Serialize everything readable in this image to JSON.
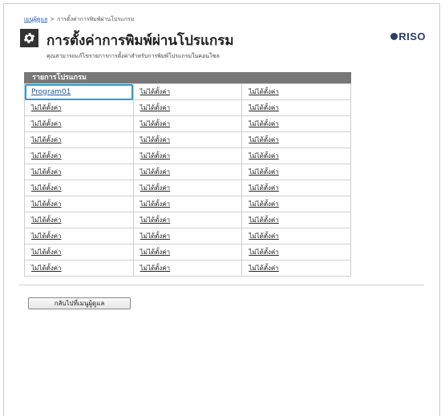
{
  "breadcrumb": {
    "home": "เมนูผู้ดูแล",
    "separator": ">",
    "current": "การตั้งค่าการพิมพ์ผ่านโปรแกรม"
  },
  "header": {
    "title": "การตั้งค่าการพิมพ์ผ่านโปรแกรม",
    "icon": "gear-icon",
    "logo_text": "RISO",
    "subtitle": "คุณสามารถแก้ไขรายการการตั้งค่าสำหรับการพิมพ์โปรแกรมในคอนโซล"
  },
  "program_list": {
    "header": "รายการโปรแกรม",
    "selected_index": 0,
    "rows": [
      [
        "Program01",
        "ไม่ได้ตั้งค่า",
        "ไม่ได้ตั้งค่า"
      ],
      [
        "ไม่ได้ตั้งค่า",
        "ไม่ได้ตั้งค่า",
        "ไม่ได้ตั้งค่า"
      ],
      [
        "ไม่ได้ตั้งค่า",
        "ไม่ได้ตั้งค่า",
        "ไม่ได้ตั้งค่า"
      ],
      [
        "ไม่ได้ตั้งค่า",
        "ไม่ได้ตั้งค่า",
        "ไม่ได้ตั้งค่า"
      ],
      [
        "ไม่ได้ตั้งค่า",
        "ไม่ได้ตั้งค่า",
        "ไม่ได้ตั้งค่า"
      ],
      [
        "ไม่ได้ตั้งค่า",
        "ไม่ได้ตั้งค่า",
        "ไม่ได้ตั้งค่า"
      ],
      [
        "ไม่ได้ตั้งค่า",
        "ไม่ได้ตั้งค่า",
        "ไม่ได้ตั้งค่า"
      ],
      [
        "ไม่ได้ตั้งค่า",
        "ไม่ได้ตั้งค่า",
        "ไม่ได้ตั้งค่า"
      ],
      [
        "ไม่ได้ตั้งค่า",
        "ไม่ได้ตั้งค่า",
        "ไม่ได้ตั้งค่า"
      ],
      [
        "ไม่ได้ตั้งค่า",
        "ไม่ได้ตั้งค่า",
        "ไม่ได้ตั้งค่า"
      ],
      [
        "ไม่ได้ตั้งค่า",
        "ไม่ได้ตั้งค่า",
        "ไม่ได้ตั้งค่า"
      ],
      [
        "ไม่ได้ตั้งค่า",
        "ไม่ได้ตั้งค่า",
        "ไม่ได้ตั้งค่า"
      ]
    ]
  },
  "footer": {
    "back_label": "กลับไปที่เมนูผู้ดูแล"
  },
  "colors": {
    "selection": "#2f9ad6",
    "table_header_bg": "#777777",
    "logo": "#2b3d6b"
  }
}
